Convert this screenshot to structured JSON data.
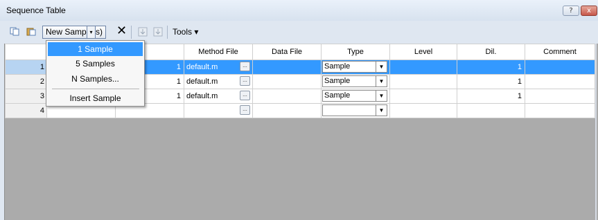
{
  "window": {
    "title": "Sequence Table",
    "help_label": "?",
    "close_label": "x"
  },
  "toolbar": {
    "new_samples_label": "New Sample(s)",
    "dropdown_arrow": "▾",
    "delete_glyph": "✕",
    "tools_label": "Tools ▾",
    "icons": [
      "copy-icon",
      "paste-icon",
      "delete-icon",
      "move-down-icon",
      "move-down-alt-icon"
    ]
  },
  "menu": {
    "items": [
      {
        "label": "1 Sample",
        "highlighted": true
      },
      {
        "label": "5 Samples",
        "highlighted": false
      },
      {
        "label": "N Samples...",
        "highlighted": false
      },
      {
        "label": "Insert Sample",
        "highlighted": false
      }
    ]
  },
  "grid": {
    "columns": [
      "",
      "",
      "",
      "Method File",
      "Data File",
      "Type",
      "Level",
      "Dil.",
      "Comment"
    ],
    "rows": [
      {
        "n": "1",
        "c2": "",
        "c3": "1",
        "method": "default.m",
        "data": "",
        "type": "Sample",
        "level": "",
        "dil": "1",
        "comment": "",
        "selected": true
      },
      {
        "n": "2",
        "c2": "",
        "c3": "1",
        "method": "default.m",
        "data": "",
        "type": "Sample",
        "level": "",
        "dil": "1",
        "comment": "",
        "selected": false
      },
      {
        "n": "3",
        "c2": "",
        "c3": "1",
        "method": "default.m",
        "data": "",
        "type": "Sample",
        "level": "",
        "dil": "1",
        "comment": "",
        "selected": false
      },
      {
        "n": "4",
        "c2": "",
        "c3": "",
        "method": "",
        "data": "",
        "type": "",
        "level": "",
        "dil": "",
        "comment": "",
        "selected": false
      }
    ]
  },
  "colors": {
    "selection": "#3399ff",
    "empty_area": "#ababab",
    "window_bg": "#dfe7f1"
  }
}
